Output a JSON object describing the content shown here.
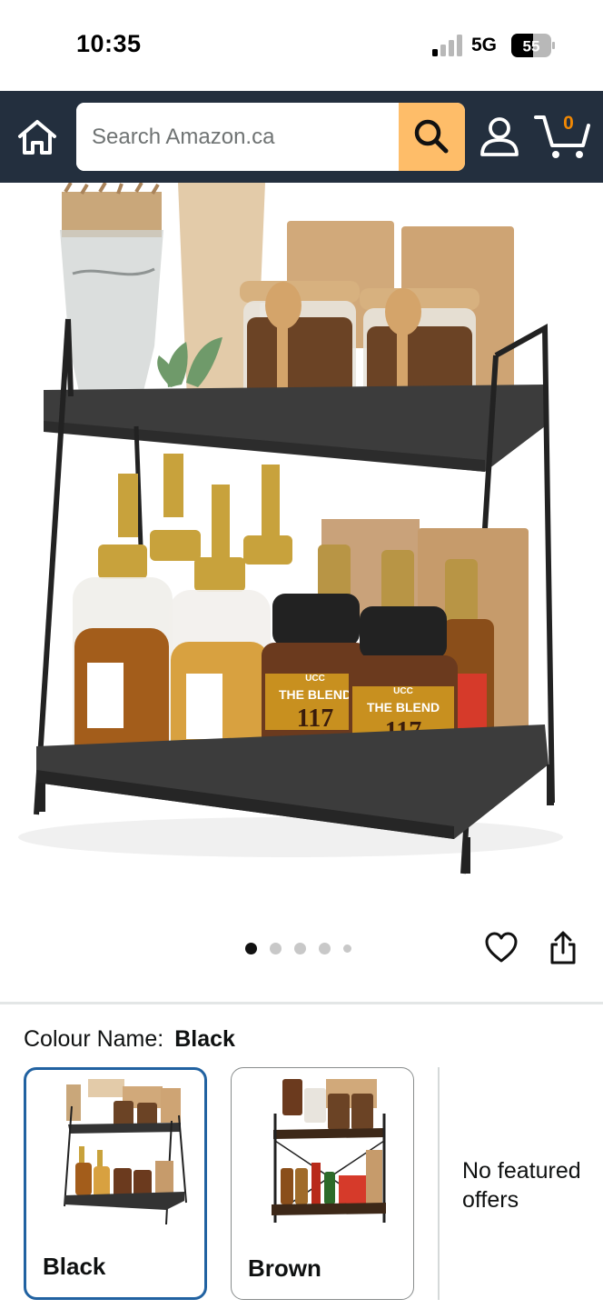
{
  "status_bar": {
    "time": "10:35",
    "network": "5G",
    "battery": "55"
  },
  "header": {
    "search_placeholder": "Search Amazon.ca",
    "cart_count": "0",
    "icons": [
      "home-icon",
      "search-icon",
      "account-icon",
      "cart-icon"
    ],
    "background": "#232f3e",
    "search_button_color": "#febd69"
  },
  "product": {
    "image_alt": "Two-tier black metal and wood countertop organizer rack holding coffee jars, syrup pump bottles, instant coffee jars and coffee bags",
    "jar_label_text": [
      "UCC",
      "THE BLEND",
      "117"
    ],
    "carousel": {
      "total": 5,
      "active_index": 0
    },
    "actions": [
      "heart-icon",
      "share-icon"
    ]
  },
  "colour": {
    "label": "Colour Name:",
    "selected": "Black",
    "options": [
      {
        "label": "Black",
        "selected": true
      },
      {
        "label": "Brown",
        "selected": false
      }
    ],
    "no_offers_text": "No featured offers",
    "selected_border_color": "#2162a1"
  }
}
